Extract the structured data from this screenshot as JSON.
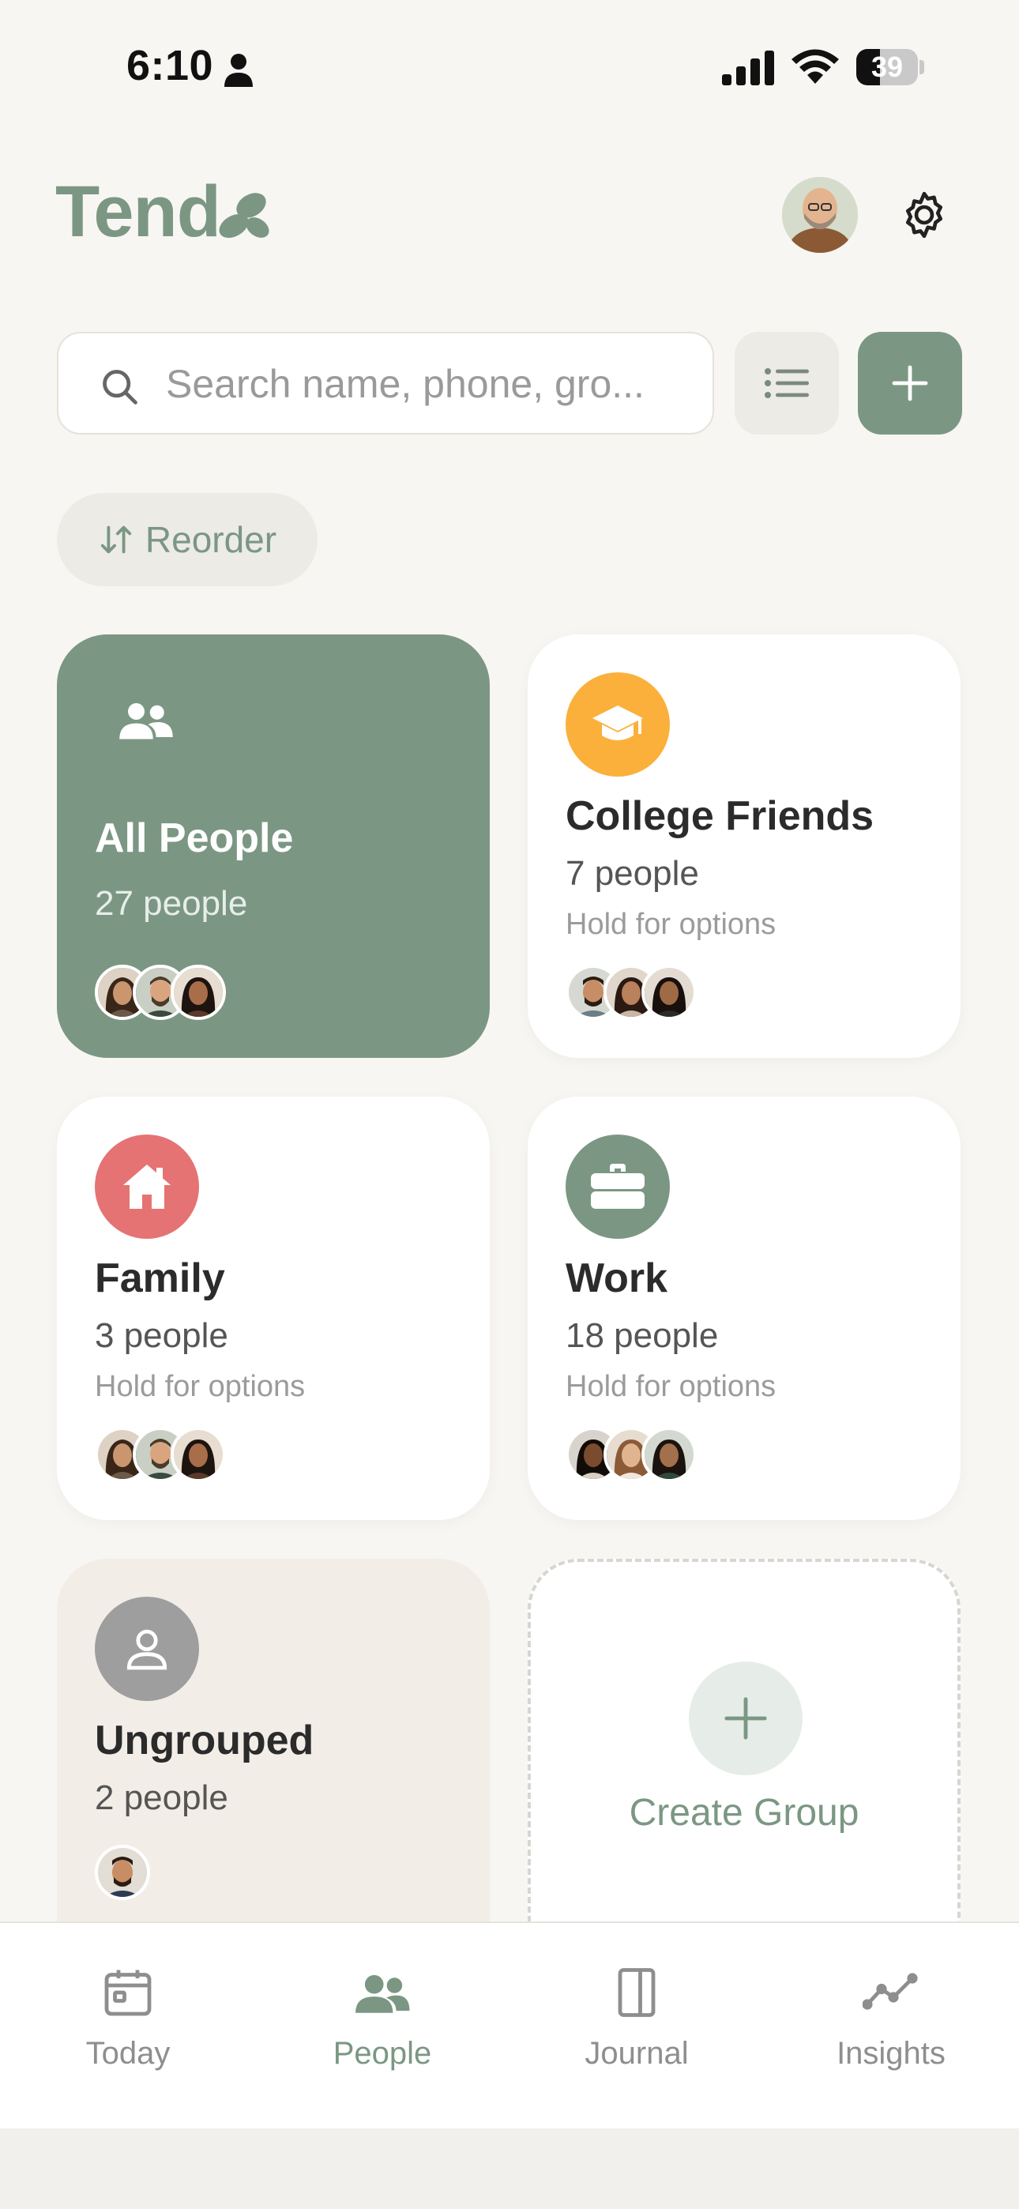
{
  "status_bar": {
    "time": "6:10",
    "battery": "39",
    "battery_level": 0.39
  },
  "header": {
    "app_title": "Tend"
  },
  "search": {
    "placeholder": "Search name, phone, gro..."
  },
  "reorder": {
    "label": "Reorder"
  },
  "groups": [
    {
      "name": "All People",
      "count": "27 people",
      "icon": "people-icon",
      "color": "#7b9783"
    },
    {
      "name": "College Friends",
      "count": "7 people",
      "hint": "Hold for options",
      "icon": "graduation-cap-icon",
      "color": "#fbb03b"
    },
    {
      "name": "Family",
      "count": "3 people",
      "hint": "Hold for options",
      "icon": "home-icon",
      "color": "#e57373"
    },
    {
      "name": "Work",
      "count": "18 people",
      "hint": "Hold for options",
      "icon": "briefcase-icon",
      "color": "#7b9783"
    },
    {
      "name": "Ungrouped",
      "count": "2 people",
      "icon": "person-icon",
      "color": "#9e9e9e"
    }
  ],
  "create_group": {
    "label": "Create Group"
  },
  "tabs": [
    {
      "label": "Today",
      "icon": "calendar-icon"
    },
    {
      "label": "People",
      "icon": "people-icon",
      "active": true
    },
    {
      "label": "Journal",
      "icon": "book-icon"
    },
    {
      "label": "Insights",
      "icon": "chart-line-icon"
    }
  ],
  "colors": {
    "accent": "#7b9783",
    "background": "#f8f6f2",
    "card": "#ffffff",
    "ungrouped_bg": "#f2eee7"
  }
}
